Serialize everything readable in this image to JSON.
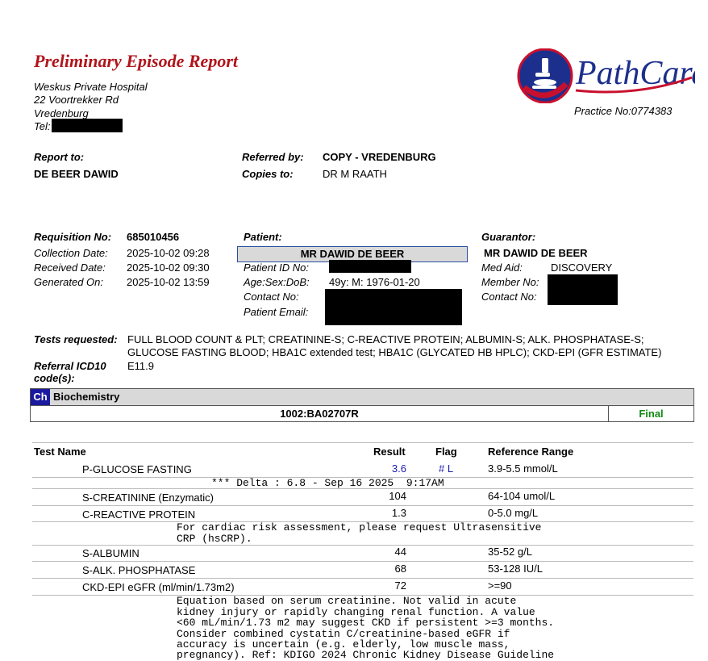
{
  "report": {
    "title": "Preliminary Episode Report",
    "hospital": {
      "name": "Weskus Private Hospital",
      "street": "22 Voortrekker Rd",
      "town": "Vredenburg",
      "tel_label": "Tel:"
    },
    "logo_text": "PathCare",
    "practice_no": "Practice No:0774383"
  },
  "report_to": {
    "label": "Report to:",
    "value": "DE BEER DAWID"
  },
  "referred_by": {
    "label": "Referred by:",
    "value": "COPY - VREDENBURG"
  },
  "copies_to": {
    "label": "Copies to:",
    "value": "DR M RAATH"
  },
  "requisition": {
    "no_label": "Requisition No:",
    "no_value": "685010456",
    "collection_label": "Collection Date:",
    "collection_value": "2025-10-02 09:28",
    "received_label": "Received Date:",
    "received_value": "2025-10-02 09:30",
    "generated_label": "Generated On:",
    "generated_value": "2025-10-02 13:59"
  },
  "patient": {
    "label": "Patient:",
    "name": "MR DAWID DE BEER",
    "id_label": "Patient ID No:",
    "asd_label": "Age:Sex:DoB:",
    "asd_value": "49y: M: 1976-01-20",
    "contact_label": "Contact No:",
    "email_label": "Patient Email:"
  },
  "guarantor": {
    "label": "Guarantor:",
    "name": "MR DAWID DE BEER",
    "medaid_label": "Med Aid:",
    "medaid_value": "DISCOVERY",
    "member_label": "Member No:",
    "contact_label": "Contact No:"
  },
  "tests_requested": {
    "label": "Tests requested:",
    "line1": "FULL BLOOD COUNT & PLT; CREATININE-S; C-REACTIVE PROTEIN; ALBUMIN-S; ALK. PHOSPHATASE-S;",
    "line2": "GLUCOSE FASTING BLOOD; HBA1C extended test; HBA1C (GLYCATED HB HPLC); CKD-EPI (GFR ESTIMATE)"
  },
  "icd10": {
    "label1": "Referral ICD10",
    "label2": "code(s):",
    "value": "E11.9"
  },
  "section": {
    "badge": "Ch",
    "title": "Biochemistry",
    "lab_id": "1002:BA02707R",
    "status": "Final",
    "status_color": "#118a11"
  },
  "table_headers": {
    "name": "Test Name",
    "result": "Result",
    "flag": "Flag",
    "ref": "Reference Range"
  },
  "tests": [
    {
      "name": "P-GLUCOSE FASTING",
      "result": "3.6",
      "flag": "# L",
      "ref": "3.9-5.5 mmol/L"
    },
    {
      "name": "S-CREATININE (Enzymatic)",
      "result": "104",
      "flag": "",
      "ref": "64-104 umol/L"
    },
    {
      "name": "C-REACTIVE PROTEIN",
      "result": "1.3",
      "flag": "",
      "ref": "0-5.0 mg/L"
    },
    {
      "name": "S-ALBUMIN",
      "result": "44",
      "flag": "",
      "ref": "35-52 g/L"
    },
    {
      "name": "S-ALK. PHOSPHATASE",
      "result": "68",
      "flag": "",
      "ref": "53-128 IU/L"
    },
    {
      "name": "CKD-EPI eGFR (ml/min/1.73m2)",
      "result": "72",
      "flag": "",
      "ref": ">=90"
    }
  ],
  "notes": {
    "delta": "*** Delta : 6.8 - Sep 16 2025  9:17AM",
    "crp1": "For cardiac risk assessment, please request Ultrasensitive",
    "crp2": "CRP (hsCRP).",
    "egfr1": "Equation based on serum creatinine. Not valid in acute",
    "egfr2": "kidney injury or rapidly changing renal function. A value",
    "egfr3": "<60 mL/min/1.73 m2 may suggest CKD if persistent >=3 months.",
    "egfr4": "Consider combined cystatin C/creatinine-based eGFR if",
    "egfr5": "accuracy is uncertain (e.g. elderly, low muscle mass,",
    "egfr6": "pregnancy). Ref: KDIGO 2024 Chronic Kidney Disease Guideline"
  }
}
